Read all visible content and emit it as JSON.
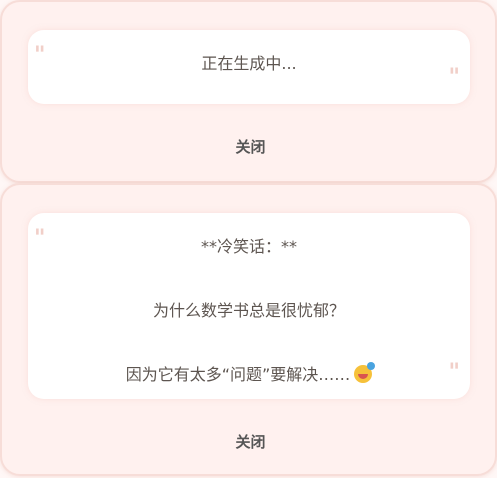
{
  "cards": [
    {
      "message_lines": [
        "正在生成中..."
      ],
      "close_label": "关闭"
    },
    {
      "message_lines": [
        "**冷笑话：**",
        "为什么数学书总是很忧郁？",
        "因为它有太多“问题”要解决……"
      ],
      "close_label": "关闭",
      "emoji": "star-struck-emoji"
    }
  ],
  "quote_open": "\"",
  "quote_close": "\""
}
